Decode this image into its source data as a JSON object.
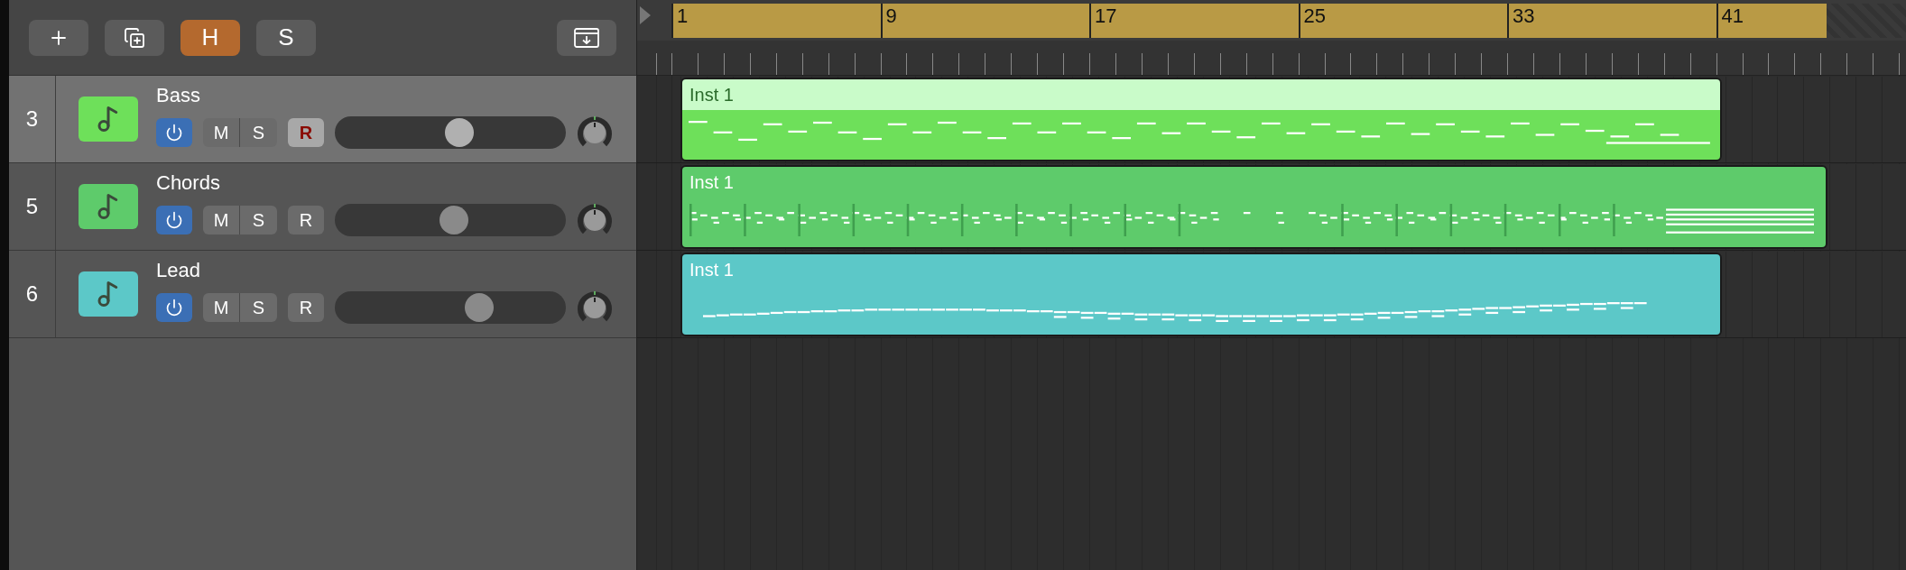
{
  "toolbar": [
    {
      "kind": "add"
    },
    {
      "kind": "duplicate"
    },
    {
      "kind": "toggle",
      "label": "H",
      "selected": true
    },
    {
      "kind": "toggle",
      "label": "S",
      "selected": false
    },
    {
      "kind": "download"
    }
  ],
  "ruler": {
    "bars": [
      "1",
      "9",
      "17",
      "25",
      "33",
      "41"
    ]
  },
  "tracks": [
    {
      "number": "3",
      "name": "Bass",
      "color": "#6ee05a",
      "selected": true,
      "on": true,
      "mute_label": "M",
      "solo_label": "S",
      "record_label": "R",
      "record": true,
      "level": 0.55,
      "region": {
        "name": "Inst 1",
        "kind": "bass",
        "selected": true,
        "level": 0.85
      }
    },
    {
      "number": "5",
      "name": "Chords",
      "color": "#5ecb6b",
      "selected": false,
      "on": true,
      "mute_label": "M",
      "solo_label": "S",
      "record_label": "R",
      "record": false,
      "level": 0.52,
      "region": {
        "name": "Inst 1",
        "kind": "chords",
        "selected": false,
        "level": 0.936
      }
    },
    {
      "number": "6",
      "name": "Lead",
      "color": "#5cc8c8",
      "selected": false,
      "on": true,
      "mute_label": "M",
      "solo_label": "S",
      "record_label": "R",
      "record": false,
      "level": 0.66,
      "region": {
        "name": "Inst 1",
        "kind": "melody",
        "selected": false,
        "level": 0.85
      }
    }
  ]
}
